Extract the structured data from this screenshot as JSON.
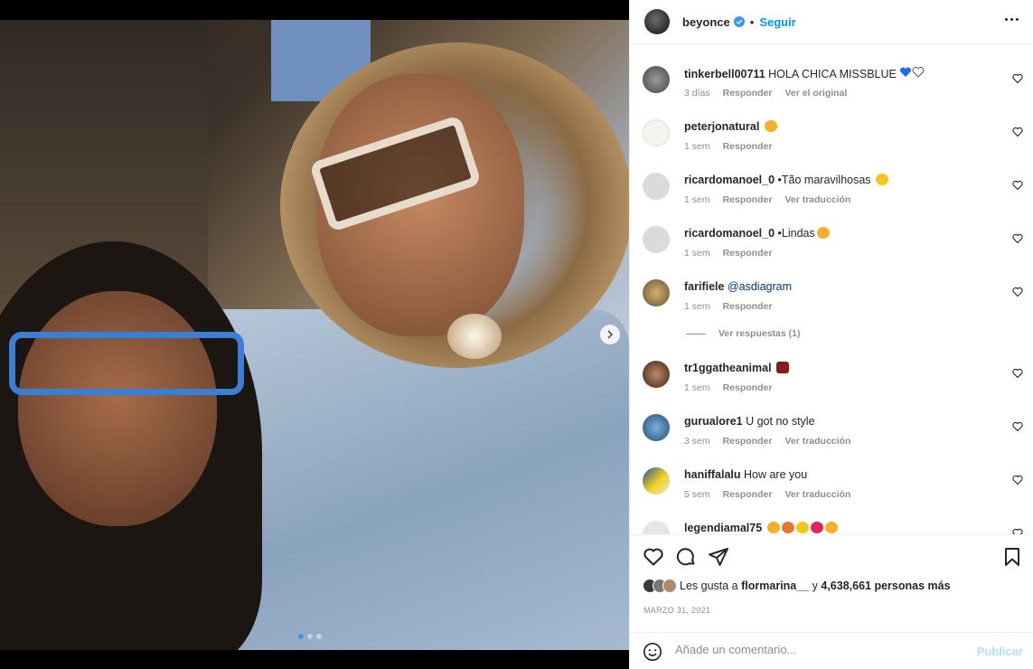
{
  "header": {
    "username": "beyonce",
    "separator": "•",
    "follow_label": "Seguir",
    "verified_icon": "verified-badge-icon",
    "more_icon": "more-options-icon"
  },
  "comments": [
    {
      "user": "tinkerbell00711",
      "text": "HOLA CHICA MISSBLUE",
      "emoji": [
        "blue-heart",
        "white-heart"
      ],
      "time": "3 días",
      "reply": "Responder",
      "extra": "Ver el original"
    },
    {
      "user": "peterjonatural",
      "text": "",
      "emoji": [
        "heart-eyes-face"
      ],
      "time": "1 sem",
      "reply": "Responder",
      "extra": ""
    },
    {
      "user": "ricardomanoel_0",
      "text": "•Tão maravilhosas",
      "emoji": [
        "pleading-face"
      ],
      "time": "1 sem",
      "reply": "Responder",
      "extra": "Ver traducción"
    },
    {
      "user": "ricardomanoel_0",
      "text": "•Lindas",
      "emoji": [
        "heart-eyes-face"
      ],
      "time": "1 sem",
      "reply": "Responder",
      "extra": ""
    },
    {
      "user": "farifiele",
      "text": "@asdiagram",
      "emoji": [],
      "time": "1 sem",
      "reply": "Responder",
      "extra": ""
    },
    {
      "user": "tr1ggatheanimal",
      "text": "",
      "emoji": [
        "fire"
      ],
      "time": "1 sem",
      "reply": "Responder",
      "extra": ""
    },
    {
      "user": "gurualore1",
      "text": "U got no style",
      "emoji": [],
      "time": "3 sem",
      "reply": "Responder",
      "extra": "Ver traducción"
    },
    {
      "user": "haniffalalu",
      "text": "How are you",
      "emoji": [],
      "time": "5 sem",
      "reply": "Responder",
      "extra": "Ver traducción"
    },
    {
      "user": "legendiamal75",
      "text": "",
      "emoji": [
        "heart-eyes-face",
        "fire",
        "face",
        "heart",
        "heart-eyes-face"
      ],
      "time": "",
      "reply": "",
      "extra": ""
    }
  ],
  "view_replies": "Ver respuestas (1)",
  "likes": {
    "prefix": "Les gusta a",
    "user": "flormarina__",
    "and": "y",
    "count": "4,638,661 personas más"
  },
  "date": "MARZO 31, 2021",
  "add_comment": {
    "placeholder": "Añade un comentario...",
    "publish_label": "Publicar"
  },
  "colors": {
    "accent": "#0095f6",
    "publish_disabled": "#b2dffc",
    "text": "#262626",
    "muted": "#8e8e8e"
  }
}
